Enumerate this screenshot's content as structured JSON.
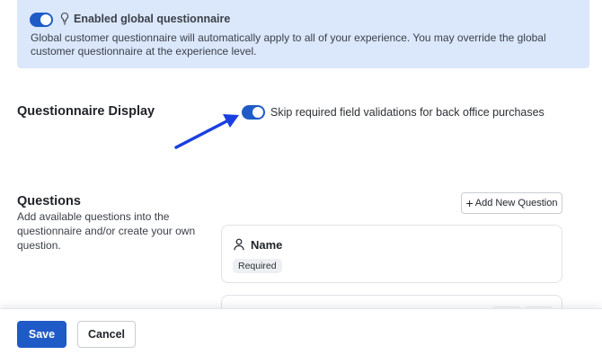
{
  "banner": {
    "title": "Enabled global questionnaire",
    "text": "Global customer questionnaire will automatically apply to all of your experience. You may override the global customer questionnaire at the experience level.",
    "toggle_on": true
  },
  "questionnaire_display": {
    "title": "Questionnaire Display",
    "skip_label": "Skip required field validations for back office purchases",
    "skip_on": true
  },
  "questions": {
    "title": "Questions",
    "description": "Add available questions into the questionnaire and/or create your own question.",
    "add_button": "Add New Question",
    "items": [
      {
        "name": "Name",
        "badge": "Required"
      }
    ]
  },
  "footer": {
    "save_label": "Save",
    "cancel_label": "Cancel"
  },
  "colors": {
    "accent": "#1f5bc6",
    "banner_bg": "#dbe7fb",
    "annotation_arrow": "#1a3fe0"
  },
  "icons": [
    "toggle-switch",
    "lightbulb-icon",
    "arrow-annotation",
    "plus-icon",
    "person-icon"
  ]
}
